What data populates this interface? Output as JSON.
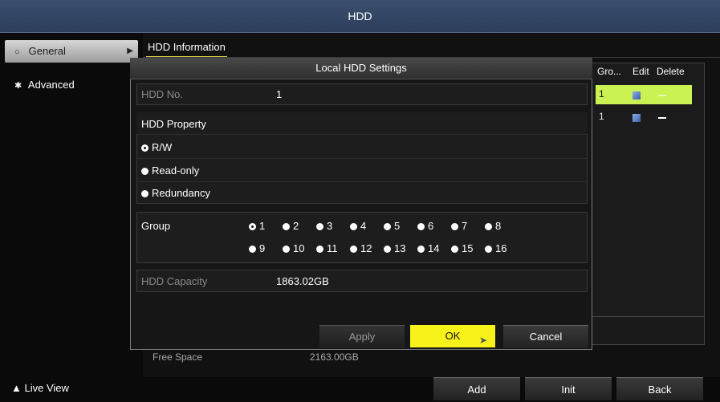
{
  "window": {
    "title": "HDD"
  },
  "sidebar": {
    "items": [
      {
        "label": "General",
        "selected": true
      },
      {
        "label": "Advanced",
        "selected": false
      }
    ],
    "live_view": "Live View"
  },
  "tabs": [
    {
      "label": "HDD Information",
      "active": true
    }
  ],
  "table": {
    "headers": [
      "Gro...",
      "Edit",
      "Delete"
    ],
    "rows": [
      {
        "group": "1",
        "highlighted": true
      },
      {
        "group": "1",
        "highlighted": false
      }
    ]
  },
  "background": {
    "free_space_label": "Free Space",
    "free_space_value": "2163.00GB"
  },
  "footer": {
    "add": "Add",
    "init": "Init",
    "back": "Back"
  },
  "dialog": {
    "title": "Local HDD Settings",
    "hdd_no_label": "HDD No.",
    "hdd_no_value": "1",
    "property_label": "HDD Property",
    "property_options": [
      {
        "label": "R/W",
        "selected": true
      },
      {
        "label": "Read-only",
        "selected": false
      },
      {
        "label": "Redundancy",
        "selected": false
      }
    ],
    "group_label": "Group",
    "group_options": [
      "1",
      "2",
      "3",
      "4",
      "5",
      "6",
      "7",
      "8",
      "9",
      "10",
      "11",
      "12",
      "13",
      "14",
      "15",
      "16"
    ],
    "group_selected": "1",
    "capacity_label": "HDD Capacity",
    "capacity_value": "1863.02GB",
    "buttons": {
      "apply": "Apply",
      "ok": "OK",
      "cancel": "Cancel"
    }
  },
  "colors": {
    "accent": "#f6f21a",
    "row_highlight": "#c9f252",
    "titlebar": "#2c3e5c"
  }
}
